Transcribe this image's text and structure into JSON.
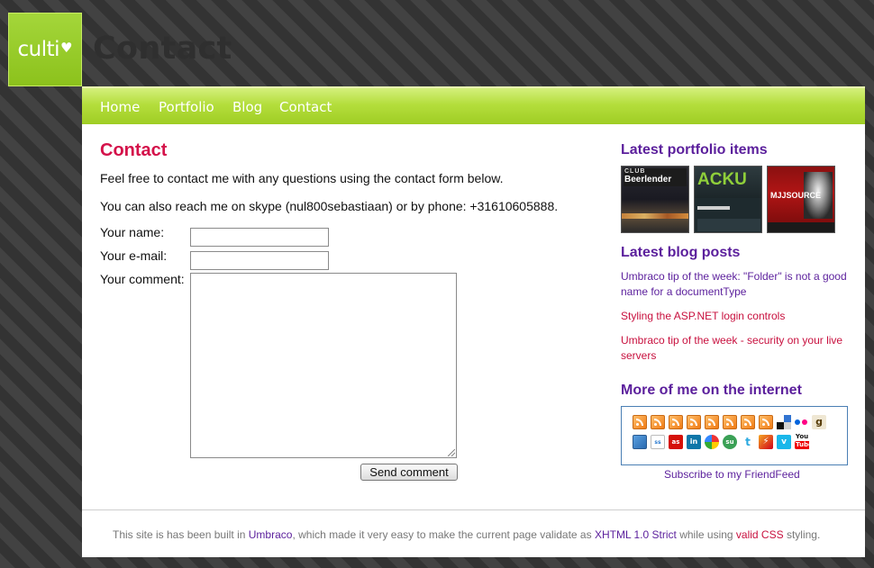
{
  "header": {
    "logo_text": "culti",
    "logo_heart": "♥",
    "site_title": "Contact"
  },
  "nav": {
    "items": [
      "Home",
      "Portfolio",
      "Blog",
      "Contact"
    ]
  },
  "main": {
    "heading": "Contact",
    "intro": "Feel free to contact me with any questions using the contact form below.",
    "skype": "You can also reach me on skype (nul800sebastiaan) or by phone: +31610605888.",
    "form": {
      "name_label": "Your name:",
      "email_label": "Your e-mail:",
      "comment_label": "Your comment:",
      "name_value": "",
      "email_value": "",
      "comment_value": "",
      "send_label": "Send comment"
    }
  },
  "sidebar": {
    "portfolio_heading": "Latest portfolio items",
    "portfolio_items": [
      {
        "caption_top": "CLUB",
        "caption_main": "Beerlender"
      },
      {
        "caption_top": "",
        "caption_main": "ACKU"
      },
      {
        "caption_top": "",
        "caption_main": "MJJSOURCE"
      }
    ],
    "blog_heading": "Latest blog posts",
    "blog_posts": [
      "Umbraco tip of the week: \"Folder\" is not a good name for a documentType",
      "Styling the ASP.NET login controls",
      "Umbraco tip of the week - security on your live servers"
    ],
    "internet_heading": "More of me on the internet",
    "subscribe_text": "Subscribe to my FriendFeed",
    "icons_row1": [
      "rss-icon",
      "rss-icon",
      "rss-icon",
      "rss-icon",
      "rss-icon",
      "rss-icon",
      "rss-icon",
      "rss-icon",
      "delicious-icon",
      "flickr-icon",
      "goodreads-icon"
    ],
    "icons_row2": [
      "feed-icon",
      "slideshare-icon",
      "lastfm-icon",
      "linkedin-icon",
      "picasa-icon",
      "stumbleupon-icon",
      "twitter-icon",
      "lightning-icon",
      "vimeo-icon",
      "youtube-icon"
    ]
  },
  "footer": {
    "part1": "This site is has been built in ",
    "link_umbraco": "Umbraco",
    "part2": ", which made it very easy to make the current page validate as ",
    "link_xhtml": "XHTML 1.0 Strict",
    "part3": " while using ",
    "link_css": "valid CSS",
    "part4": " styling."
  },
  "colors": {
    "accent_green": "#9fcd24",
    "heading_red": "#d4124a",
    "link_purple": "#5b1f9c",
    "link_red": "#c8103e"
  }
}
